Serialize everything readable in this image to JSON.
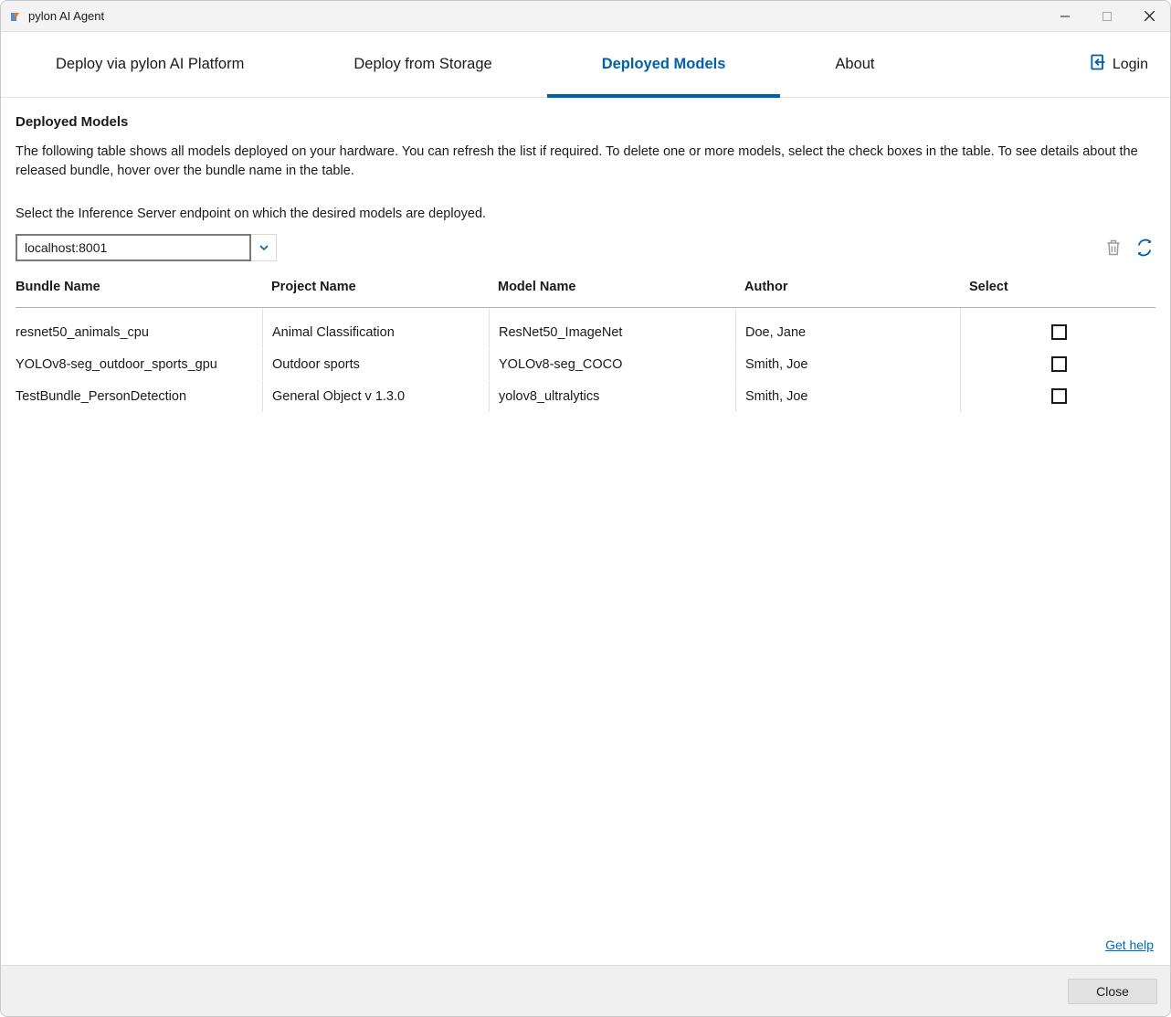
{
  "window": {
    "title": "pylon AI Agent"
  },
  "tabs": {
    "deploy_platform": "Deploy via pylon AI Platform",
    "deploy_storage": "Deploy from Storage",
    "deployed_models": "Deployed Models",
    "about": "About",
    "active": "deployed_models"
  },
  "login": {
    "label": "Login"
  },
  "page": {
    "heading": "Deployed Models",
    "description": "The following table shows all models deployed on your hardware. You can refresh the list if required. To delete one or more models, select the check boxes in the table. To see details about the released bundle, hover over the bundle name in the table.",
    "endpoint_instruction": "Select the Inference Server endpoint on which the desired models are deployed.",
    "endpoint_value": "localhost:8001"
  },
  "table": {
    "headers": {
      "bundle": "Bundle Name",
      "project": "Project Name",
      "model": "Model Name",
      "author": "Author",
      "select": "Select"
    },
    "rows": [
      {
        "bundle": "resnet50_animals_cpu",
        "project": "Animal Classification",
        "model": "ResNet50_ImageNet",
        "author": "Doe, Jane",
        "selected": false
      },
      {
        "bundle": "YOLOv8-seg_outdoor_sports_gpu",
        "project": "Outdoor sports",
        "model": "YOLOv8-seg_COCO",
        "author": "Smith, Joe",
        "selected": false
      },
      {
        "bundle": "TestBundle_PersonDetection",
        "project": "General Object v 1.3.0",
        "model": "yolov8_ultralytics",
        "author": "Smith, Joe",
        "selected": false
      }
    ]
  },
  "help": {
    "label": "Get help"
  },
  "footer": {
    "close": "Close"
  },
  "icons": {
    "delete": "trash-icon",
    "refresh": "refresh-icon",
    "chevron": "chevron-down-icon",
    "login": "login-icon",
    "minimize": "minimize-icon",
    "maximize": "maximize-icon",
    "close_window": "close-icon"
  }
}
